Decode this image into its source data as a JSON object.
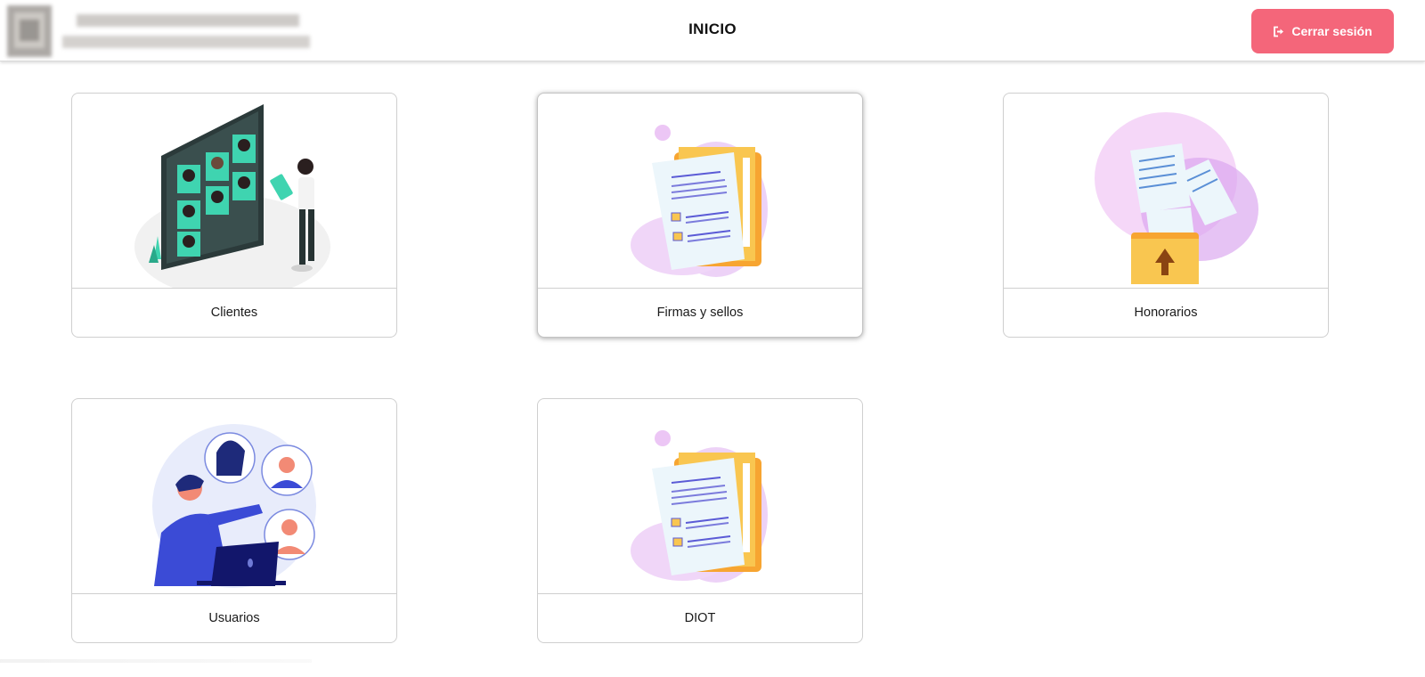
{
  "header": {
    "title": "INICIO",
    "logout_label": "Cerrar sesión",
    "logout_icon": "sign-out-icon"
  },
  "cards": [
    {
      "label": "Clientes",
      "illustration": "client-board-illustration"
    },
    {
      "label": "Firmas y sellos",
      "illustration": "documents-folder-illustration"
    },
    {
      "label": "Honorarios",
      "illustration": "folder-upload-illustration"
    },
    {
      "label": "Usuarios",
      "illustration": "users-network-illustration"
    },
    {
      "label": "DIOT",
      "illustration": "documents-folder-illustration"
    }
  ],
  "colors": {
    "logout_button": "#f4667a",
    "accent_green": "#3fd4b0",
    "accent_purple": "#d9a3ee",
    "accent_orange": "#f7a531",
    "accent_blue": "#5b5bd6"
  }
}
